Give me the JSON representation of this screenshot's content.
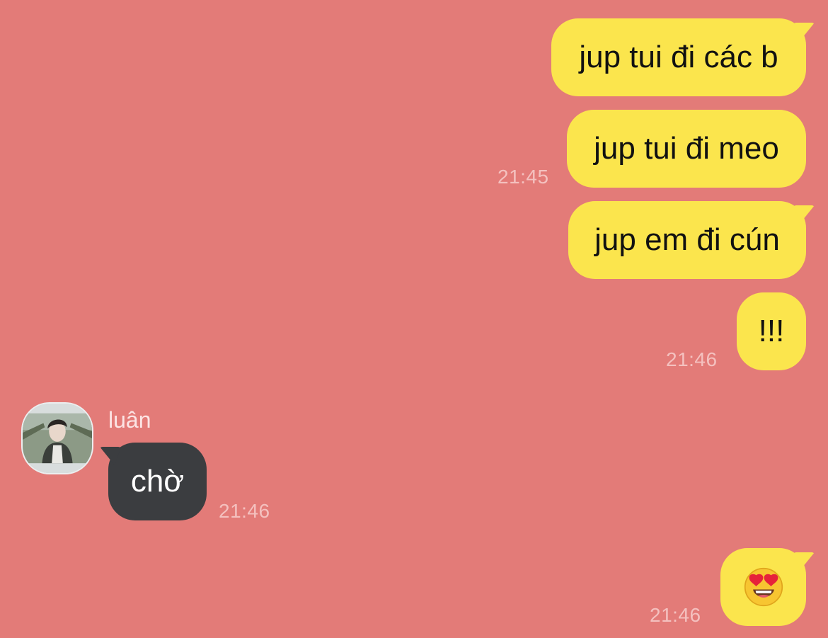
{
  "theme": {
    "background": "#e37b78",
    "outgoing_bubble": "#fbe54d",
    "incoming_bubble": "#3b3d40"
  },
  "messages": [
    {
      "direction": "outgoing",
      "text": "jup tui đi các b"
    },
    {
      "direction": "outgoing",
      "text": "jup tui đi meo",
      "time": "21:45"
    },
    {
      "direction": "outgoing",
      "text": "jup em đi cún"
    },
    {
      "direction": "outgoing",
      "text": "!!!",
      "time": "21:46"
    },
    {
      "direction": "incoming",
      "sender": "luân",
      "text": "chờ",
      "time": "21:46"
    },
    {
      "direction": "outgoing",
      "emoji": "heart-eyes-emoji",
      "time": "21:46"
    }
  ]
}
